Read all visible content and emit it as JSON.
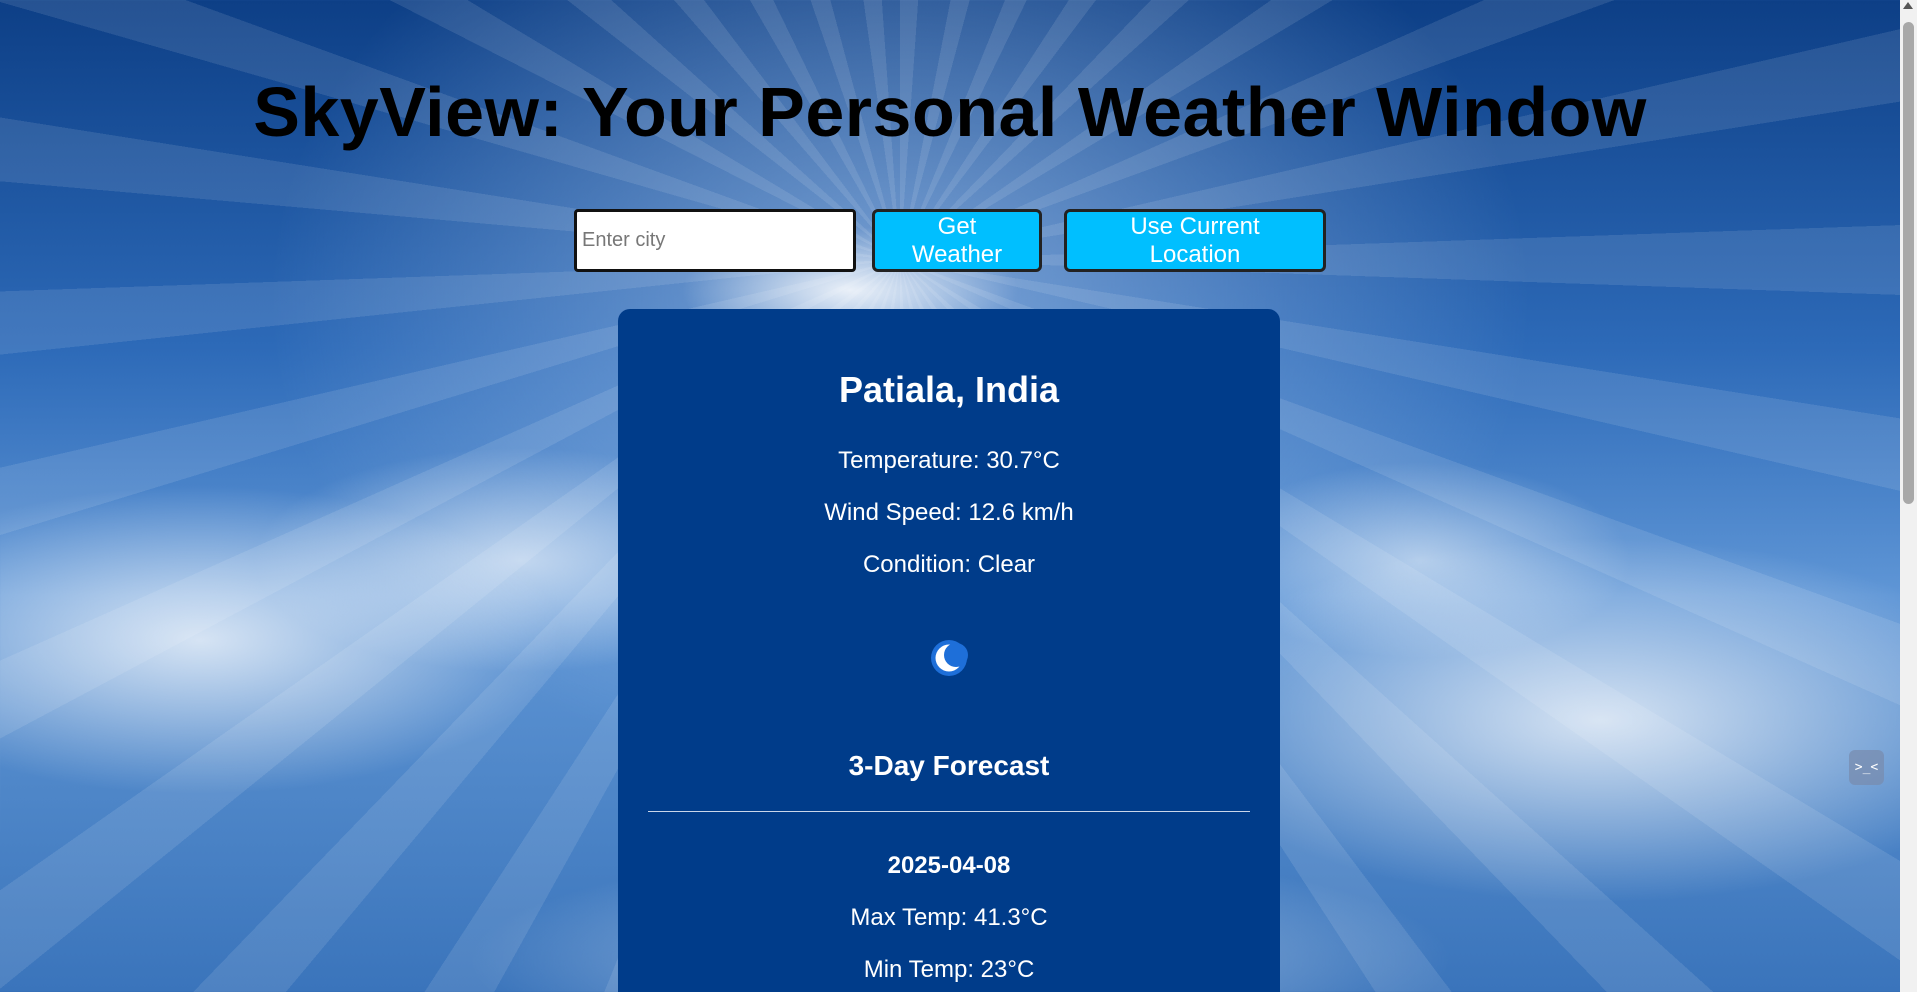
{
  "app": {
    "title": "SkyView: Your Personal Weather Window"
  },
  "search": {
    "placeholder": "Enter city",
    "value": "",
    "get_weather_label": "Get Weather",
    "current_location_label": "Use Current Location"
  },
  "current": {
    "location": "Patiala, India",
    "temperature": "Temperature: 30.7°C",
    "wind_speed": "Wind Speed: 12.6 km/h",
    "condition": "Condition: Clear",
    "icon": "crescent-moon-icon"
  },
  "forecast": {
    "title": "3-Day Forecast",
    "days": [
      {
        "date": "2025-04-08",
        "max_temp": "Max Temp: 41.3°C",
        "min_temp": "Min Temp: 23°C"
      }
    ]
  },
  "devtools": {
    "badge_text": ">_<"
  },
  "colors": {
    "accent": "#00bfff",
    "card": "#003c8a"
  }
}
